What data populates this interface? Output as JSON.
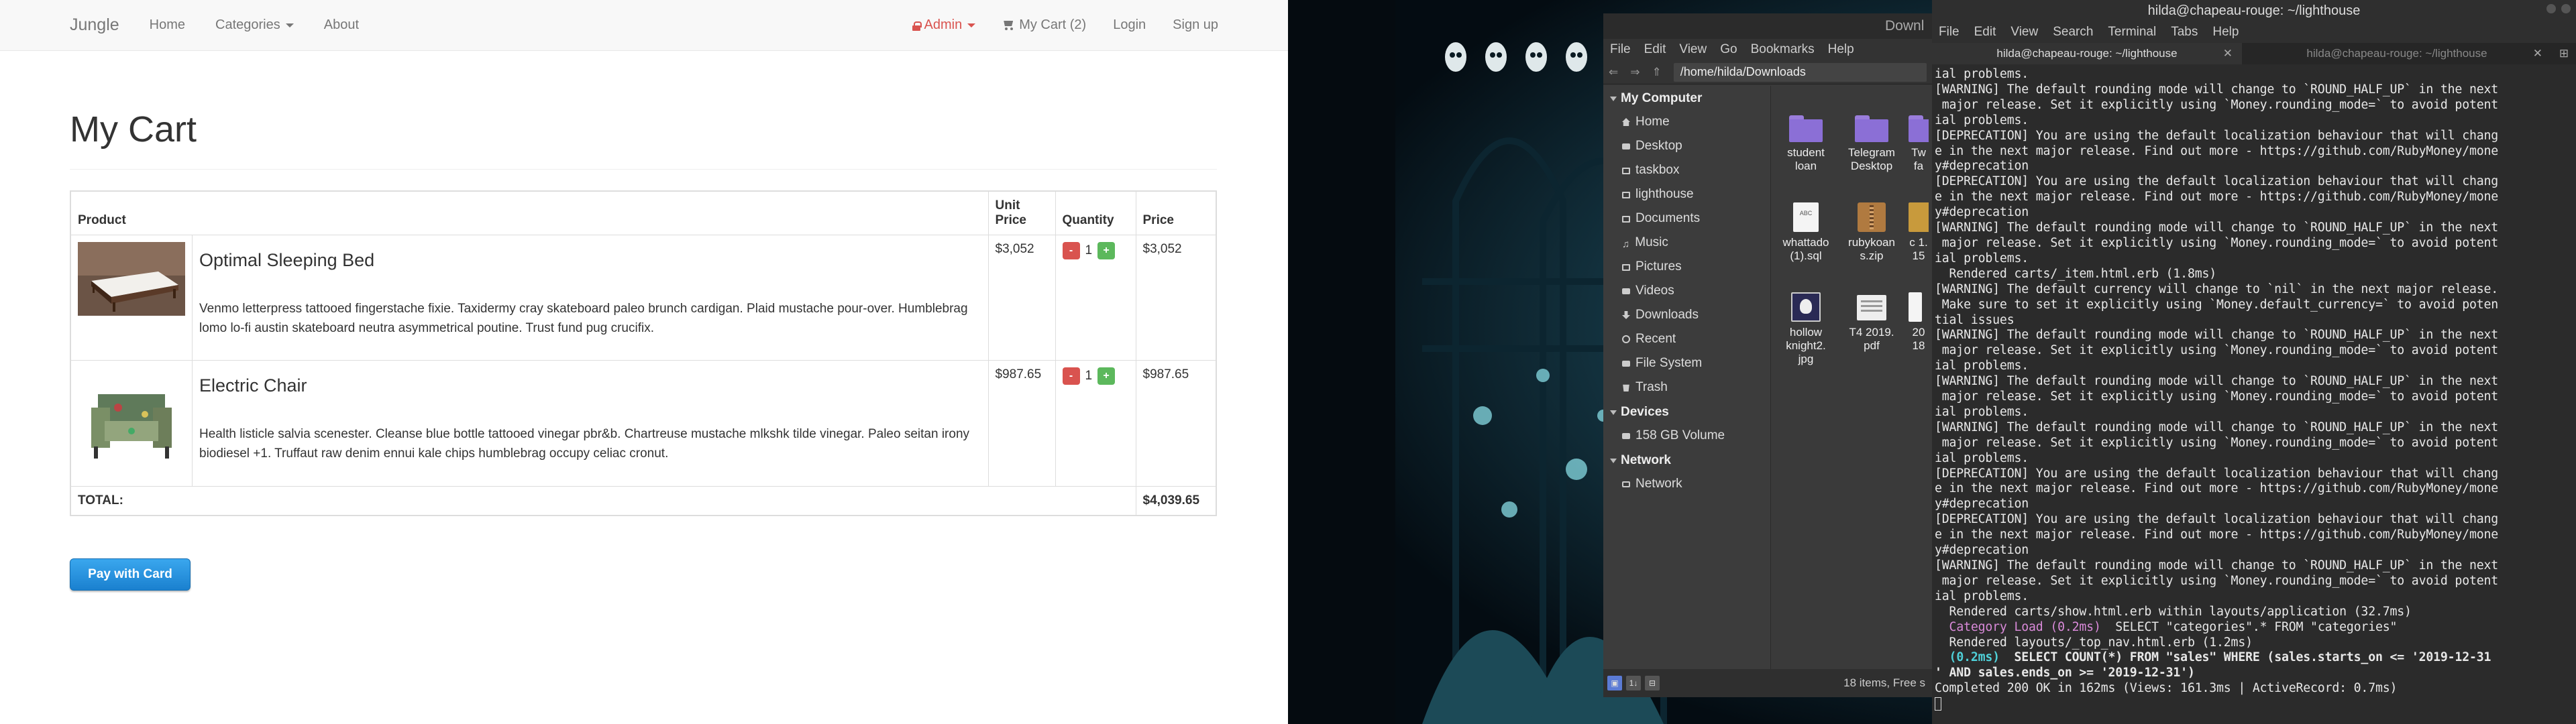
{
  "browser": {
    "navbar": {
      "brand": "Jungle",
      "home": "Home",
      "categories": "Categories",
      "about": "About",
      "admin": "Admin",
      "cart": "My Cart (2)",
      "login": "Login",
      "signup": "Sign up"
    },
    "page_title": "My Cart",
    "table": {
      "headers": {
        "product": "Product",
        "unit_price": "Unit Price",
        "quantity": "Quantity",
        "price": "Price"
      },
      "rows": [
        {
          "name": "Optimal Sleeping Bed",
          "description": "Venmo letterpress tattooed fingerstache fixie. Taxidermy cray skateboard paleo brunch cardigan. Plaid mustache pour-over. Humblebrag lomo lo-fi austin skateboard neutra asymmetrical poutine. Trust fund pug crucifix.",
          "unit_price": "$3,052",
          "qty": "1",
          "price": "$3,052"
        },
        {
          "name": "Electric Chair",
          "description": "Health listicle salvia scenester. Cleanse blue bottle tattooed vinegar pbr&b. Chartreuse mustache mlkshk tilde vinegar. Paleo seitan irony biodiesel +1. Truffaut raw denim ennui kale chips humblebrag occupy celiac cronut.",
          "unit_price": "$987.65",
          "qty": "1",
          "price": "$987.65"
        }
      ],
      "minus": "-",
      "plus": "+",
      "total_label": "TOTAL:",
      "total": "$4,039.65"
    },
    "pay_button": "Pay with Card"
  },
  "file_manager": {
    "title": "Downl",
    "menu": [
      "File",
      "Edit",
      "View",
      "Go",
      "Bookmarks",
      "Help"
    ],
    "path": "/home/hilda/Downloads",
    "sidebar": {
      "my_computer": "My Computer",
      "places": [
        "Home",
        "Desktop",
        "taskbox",
        "lighthouse",
        "Documents",
        "Music",
        "Pictures",
        "Videos",
        "Downloads",
        "Recent",
        "File System",
        "Trash"
      ],
      "devices": "Devices",
      "device_items": [
        "158 GB Volume"
      ],
      "network": "Network",
      "network_items": [
        "Network"
      ]
    },
    "files": [
      {
        "name": "student loan",
        "kind": "folder"
      },
      {
        "name": "Telegram Desktop",
        "kind": "folder"
      },
      {
        "name": "Tw fa",
        "kind": "folder"
      },
      {
        "name": "whattado (1).sql",
        "kind": "doc"
      },
      {
        "name": "rubykoan s.zip",
        "kind": "zip"
      },
      {
        "name": "c 1. 15",
        "kind": "doc"
      },
      {
        "name": "hollow knight2. jpg",
        "kind": "image"
      },
      {
        "name": "T4 2019. pdf",
        "kind": "pdf"
      },
      {
        "name": "20 18",
        "kind": "doc"
      }
    ],
    "status": "18 items, Free s",
    "status_icons": [
      "▣",
      "1↓",
      "⊟"
    ]
  },
  "terminal": {
    "title": "hilda@chapeau-rouge: ~/lighthouse",
    "menu": [
      "File",
      "Edit",
      "View",
      "Search",
      "Terminal",
      "Tabs",
      "Help"
    ],
    "tabs": [
      "hilda@chapeau-rouge: ~/lighthouse",
      "hilda@chapeau-rouge: ~/lighthouse"
    ],
    "lines": [
      "ial problems.",
      "[WARNING] The default rounding mode will change to `ROUND_HALF_UP` in the next",
      " major release. Set it explicitly using `Money.rounding_mode=` to avoid potent",
      "ial problems.",
      "[DEPRECATION] You are using the default localization behaviour that will chang",
      "e in the next major release. Find out more - https://github.com/RubyMoney/mone",
      "y#deprecation",
      "[DEPRECATION] You are using the default localization behaviour that will chang",
      "e in the next major release. Find out more - https://github.com/RubyMoney/mone",
      "y#deprecation",
      "[WARNING] The default rounding mode will change to `ROUND_HALF_UP` in the next",
      " major release. Set it explicitly using `Money.rounding_mode=` to avoid potent",
      "ial problems.",
      "  Rendered carts/_item.html.erb (1.8ms)",
      "[WARNING] The default currency will change to `nil` in the next major release.",
      " Make sure to set it explicitly using `Money.default_currency=` to avoid poten",
      "tial issues",
      "[WARNING] The default rounding mode will change to `ROUND_HALF_UP` in the next",
      " major release. Set it explicitly using `Money.rounding_mode=` to avoid potent",
      "ial problems.",
      "[WARNING] The default rounding mode will change to `ROUND_HALF_UP` in the next",
      " major release. Set it explicitly using `Money.rounding_mode=` to avoid potent",
      "ial problems.",
      "[WARNING] The default rounding mode will change to `ROUND_HALF_UP` in the next",
      " major release. Set it explicitly using `Money.rounding_mode=` to avoid potent",
      "ial problems.",
      "[DEPRECATION] You are using the default localization behaviour that will chang",
      "e in the next major release. Find out more - https://github.com/RubyMoney/mone",
      "y#deprecation",
      "[DEPRECATION] You are using the default localization behaviour that will chang",
      "e in the next major release. Find out more - https://github.com/RubyMoney/mone",
      "y#deprecation",
      "[WARNING] The default rounding mode will change to `ROUND_HALF_UP` in the next",
      " major release. Set it explicitly using `Money.rounding_mode=` to avoid potent",
      "ial problems.",
      "  Rendered carts/show.html.erb within layouts/application (32.7ms)"
    ],
    "cat_load_label": "Category Load (0.2ms)",
    "cat_load_sql": "  SELECT \"categories\".* FROM \"categories\"",
    "rendered_nav": "  Rendered layouts/_top_nav.html.erb (1.2ms)",
    "count_time": "(0.2ms)",
    "count_sql": "  SELECT COUNT(*) FROM \"sales\" WHERE (sales.starts_on <= '2019-12-31",
    "count_sql2": "' AND sales.ends_on >= '2019-12-31')",
    "completed": "Completed 200 OK in 162ms (Views: 161.3ms | ActiveRecord: 0.7ms)"
  },
  "colors": {
    "navbar_bg": "#f8f8f8",
    "admin": "#d9534f",
    "pay_button": "#1a80cf",
    "qty_minus": "#d9534f",
    "qty_plus": "#5cb85c",
    "terminal_bg": "#2b2b2b",
    "folder": "#8b6fd6"
  }
}
